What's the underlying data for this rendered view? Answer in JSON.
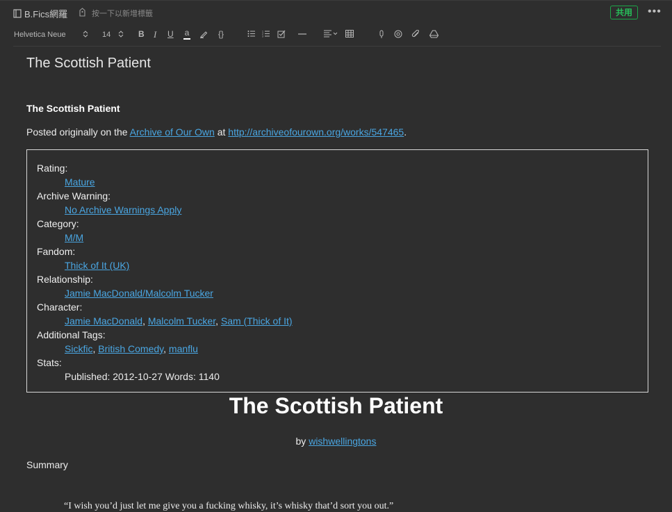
{
  "header": {
    "notebook_name": "B.Fics網羅",
    "tag_placeholder": "按一下以新增標籤",
    "share_label": "共用",
    "more_label": "•••"
  },
  "toolbar": {
    "font_family": "Helvetica Neue",
    "font_size": "14",
    "bold": "B",
    "italic": "I",
    "underline": "U",
    "text_color": "a",
    "code": "{}"
  },
  "note": {
    "title": "The Scottish Patient",
    "heading": "The Scottish Patient",
    "posted_prefix": "Posted originally on the ",
    "archive_link": "Archive of Our Own",
    "posted_mid": " at ",
    "url": "http://archiveofourown.org/works/547465",
    "posted_suffix": ".",
    "meta": {
      "rating_label": "Rating:",
      "rating": "Mature",
      "warning_label": "Archive Warning:",
      "warning": "No Archive Warnings Apply",
      "category_label": "Category:",
      "category": "M/M",
      "fandom_label": "Fandom:",
      "fandom": "Thick of It (UK)",
      "relationship_label": "Relationship:",
      "relationship": "Jamie MacDonald/Malcolm Tucker",
      "character_label": "Character:",
      "characters": [
        "Jamie MacDonald",
        "Malcolm Tucker",
        "Sam (Thick of It)"
      ],
      "tags_label": "Additional Tags:",
      "tags": [
        "Sickfic",
        "British Comedy",
        "manflu"
      ],
      "stats_label": "Stats:",
      "stats": "Published: 2012-10-27 Words: 1140"
    },
    "work_title": "The Scottish Patient",
    "by_label": "by ",
    "author": "wishwellingtons",
    "summary_label": "Summary",
    "quote": "“I wish you’d just let me give you a fucking whisky, it’s whisky that’d sort you out.”"
  }
}
